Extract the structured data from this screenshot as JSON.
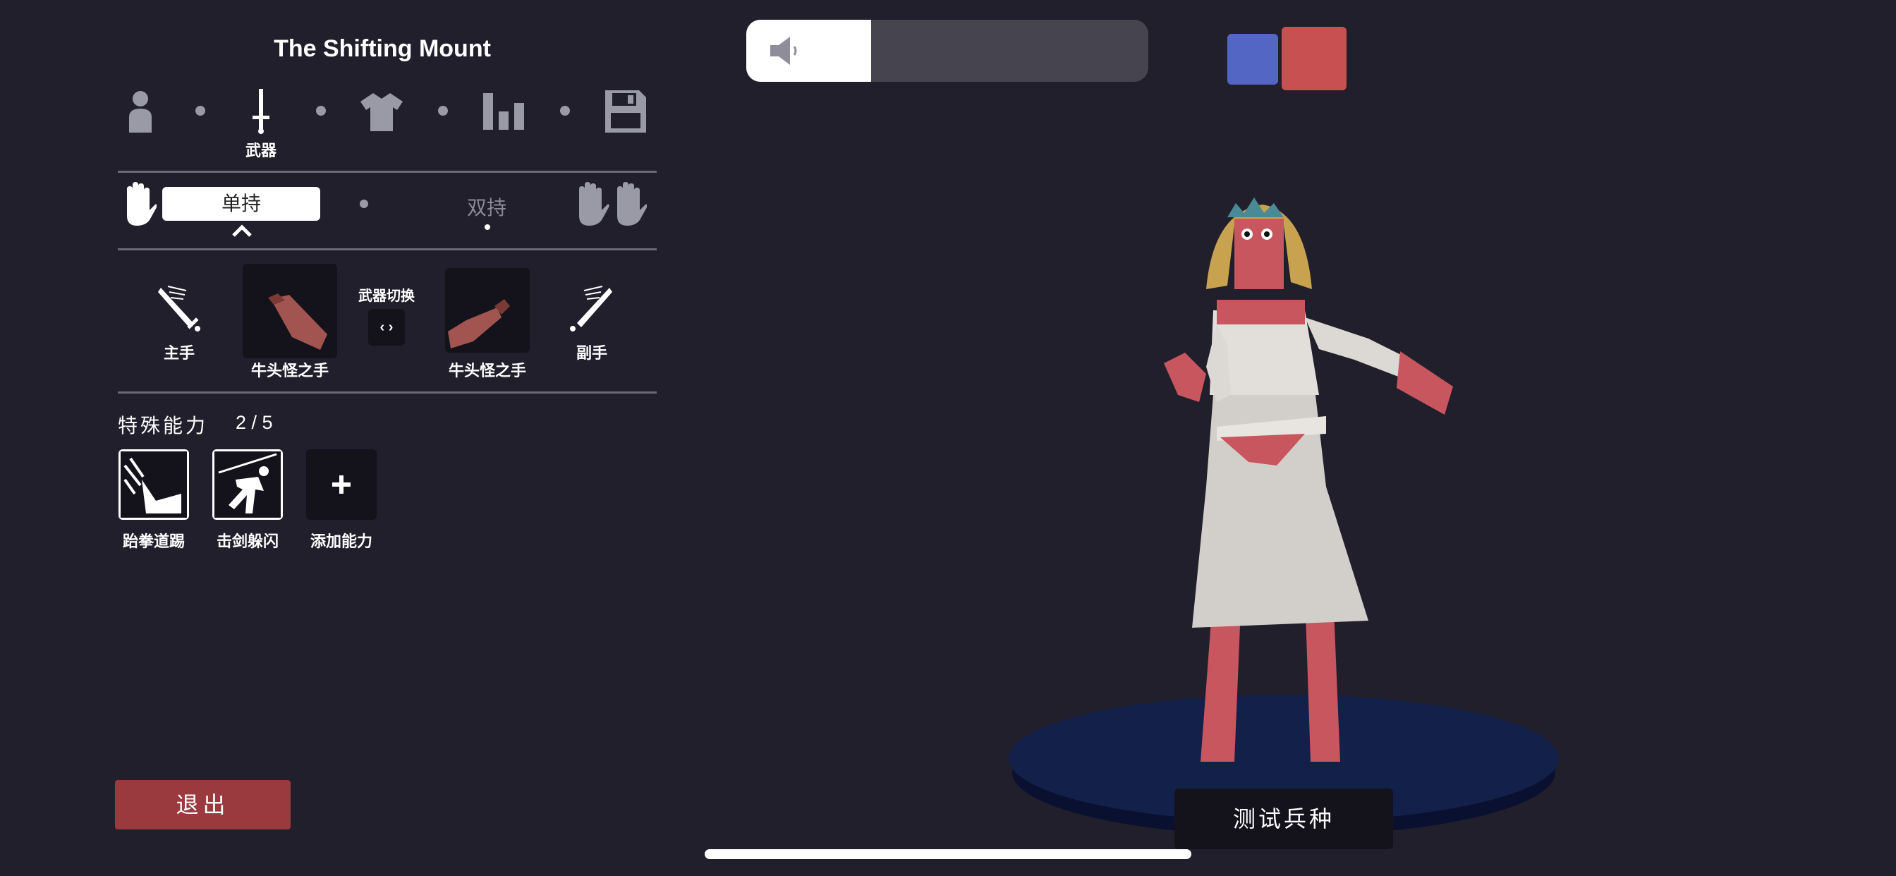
{
  "unit_name": "The Shifting Mount",
  "steps": [
    {
      "icon": "person-icon",
      "label": ""
    },
    {
      "icon": "sword-icon",
      "label": "武器"
    },
    {
      "icon": "shirt-icon",
      "label": ""
    },
    {
      "icon": "stats-icon",
      "label": ""
    },
    {
      "icon": "save-icon",
      "label": ""
    }
  ],
  "hold_mode": {
    "selected": "单持",
    "other": "双持"
  },
  "weapons": {
    "main_label": "主手",
    "main_weapon": "牛头怪之手",
    "swap_label": "武器切换",
    "swap_button": "‹ ›",
    "off_weapon": "牛头怪之手",
    "off_label": "副手"
  },
  "abilities": {
    "header": "特殊能力",
    "count": "2 / 5",
    "items": [
      {
        "icon": "kick-icon",
        "label": "跆拳道踢"
      },
      {
        "icon": "parry-icon",
        "label": "击剑躲闪"
      },
      {
        "icon": "plus-icon",
        "label": "添加能力"
      }
    ]
  },
  "exit_label": "退出",
  "volume": {
    "level": 0.31
  },
  "team_colors": {
    "blue": "#5466c4",
    "red": "#c95050"
  },
  "test_unit_label": "测试兵种",
  "accent_red": "#9b3a3e"
}
